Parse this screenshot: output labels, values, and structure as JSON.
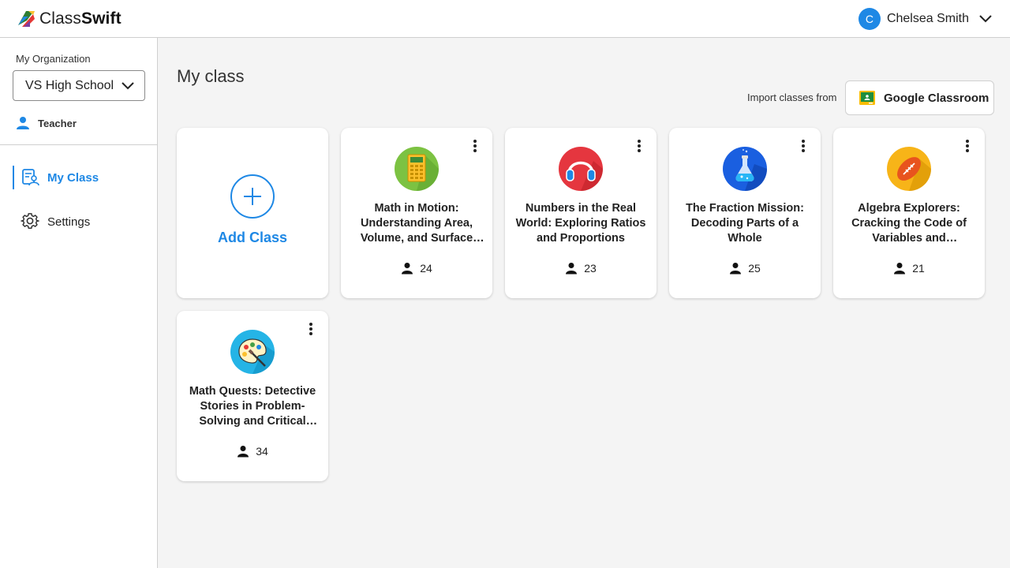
{
  "app": {
    "logo_light": "Class",
    "logo_bold": "Swift"
  },
  "user": {
    "initial": "C",
    "name": "Chelsea Smith"
  },
  "sidebar": {
    "org_label": "My Organization",
    "org_value": "VS High School",
    "role": "Teacher",
    "nav": [
      {
        "label": "My Class",
        "icon": "roster-icon",
        "active": true
      },
      {
        "label": "Settings",
        "icon": "gear-icon",
        "active": false
      }
    ]
  },
  "main": {
    "title": "My class",
    "import_label": "Import classes from",
    "import_button": "Google Classroom",
    "add_class": "Add Class",
    "classes": [
      {
        "title": "Math in Motion: Understanding Area, Volume, and Surface Area",
        "students": "24",
        "icon": "calculator-icon",
        "color": "#7cc242"
      },
      {
        "title": "Numbers in the Real World: Exploring Ratios and Proportions",
        "students": "23",
        "icon": "headphones-icon",
        "color": "#e5363f"
      },
      {
        "title": "The Fraction Mission: Decoding Parts of a Whole",
        "students": "25",
        "icon": "flask-icon",
        "color": "#1a5fe0"
      },
      {
        "title": "Algebra Explorers: Cracking the Code of Variables and Expressions",
        "students": "21",
        "icon": "football-icon",
        "color": "#f7b418"
      },
      {
        "title": "Math Quests: Detective Stories in Problem-Solving and Critical Thinking",
        "students": "34",
        "icon": "palette-icon",
        "color": "#25b4e6"
      }
    ]
  },
  "colors": {
    "accent": "#1e88e5"
  }
}
